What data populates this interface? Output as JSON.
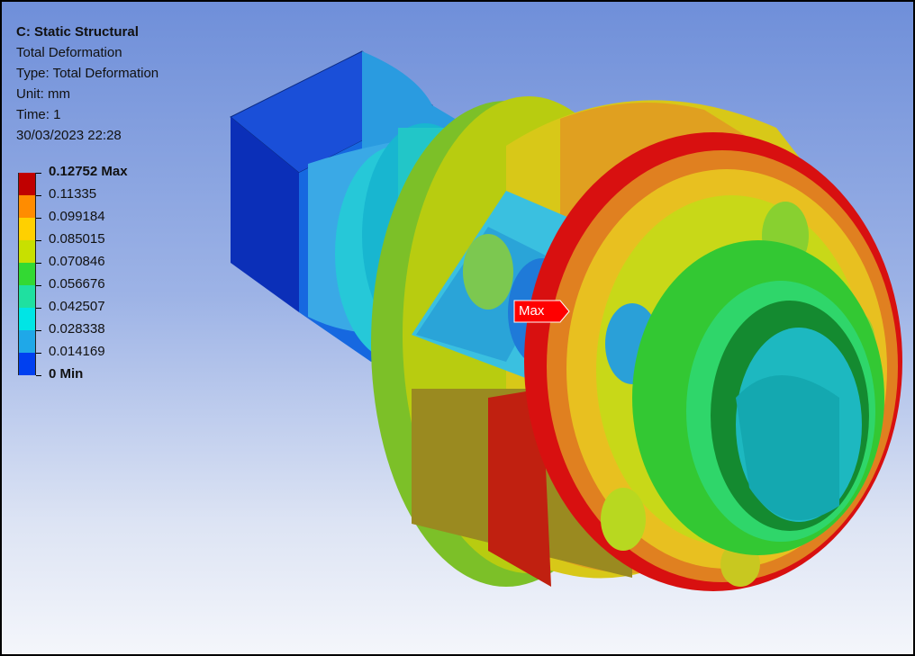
{
  "info": {
    "title": "C: Static Structural",
    "result": "Total Deformation",
    "type": "Type: Total Deformation",
    "unit": "Unit: mm",
    "time": "Time: 1",
    "timestamp": "30/03/2023 22:28"
  },
  "legend": {
    "bands": [
      {
        "label": "0.12752 Max",
        "color": "#c00000",
        "bold": true
      },
      {
        "label": "0.11335",
        "color": "#ff8c00",
        "bold": false
      },
      {
        "label": "0.099184",
        "color": "#ffd000",
        "bold": false
      },
      {
        "label": "0.085015",
        "color": "#c8e000",
        "bold": false
      },
      {
        "label": "0.070846",
        "color": "#33d933",
        "bold": false
      },
      {
        "label": "0.056676",
        "color": "#1fe0a0",
        "bold": false
      },
      {
        "label": "0.042507",
        "color": "#00e5e5",
        "bold": false
      },
      {
        "label": "0.028338",
        "color": "#1fa8e8",
        "bold": false
      },
      {
        "label": "0.014169",
        "color": "#0040f0",
        "bold": false
      },
      {
        "label": "0 Min",
        "color": "",
        "bold": true
      }
    ]
  },
  "probe": {
    "label": "Max",
    "color": "#ff0000"
  }
}
